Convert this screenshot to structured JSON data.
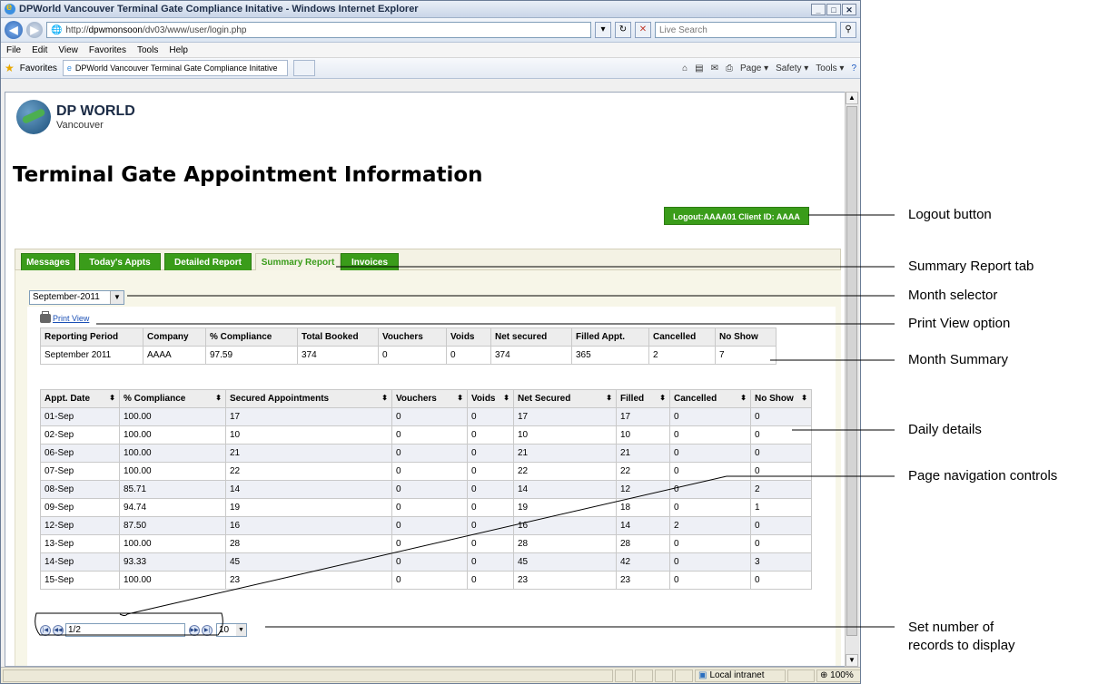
{
  "browser": {
    "title": "DPWorld Vancouver Terminal Gate Compliance Initative - Windows Internet Explorer",
    "address_prefix": "http://",
    "address_host": "dpwmonsoon",
    "address_path": "/dv03/www/user/login.php",
    "search_placeholder": "Live Search",
    "menu": [
      "File",
      "Edit",
      "View",
      "Favorites",
      "Tools",
      "Help"
    ],
    "favorites_label": "Favorites",
    "tab_title": "DPWorld Vancouver Terminal Gate Compliance Initative",
    "commands": [
      "Page ▾",
      "Safety ▾",
      "Tools ▾"
    ],
    "status_zone": "Local intranet",
    "zoom": "100%"
  },
  "page": {
    "logo_name": "DP WORLD",
    "logo_sub": "Vancouver",
    "title": "Terminal Gate Appointment Information",
    "logout_label": "Logout:AAAA01  Client ID: AAAA",
    "tabs": [
      "Messages",
      "Today's Appts",
      "Detailed Report",
      "Summary Report",
      "Invoices"
    ],
    "active_tab": "Summary Report",
    "month": "September-2011",
    "print_view": "Print View"
  },
  "summary_table": {
    "headers": [
      "Reporting Period",
      "Company",
      "% Compliance",
      "Total Booked",
      "Vouchers",
      "Voids",
      "Net secured",
      "Filled Appt.",
      "Cancelled",
      "No Show"
    ],
    "row": [
      "September 2011",
      "AAAA",
      "97.59",
      "374",
      "0",
      "0",
      "374",
      "365",
      "2",
      "7"
    ]
  },
  "daily_table": {
    "headers": [
      "Appt. Date",
      "% Compliance",
      "Secured Appointments",
      "Vouchers",
      "Voids",
      "Net Secured",
      "Filled",
      "Cancelled",
      "No Show"
    ],
    "rows": [
      [
        "01-Sep",
        "100.00",
        "17",
        "0",
        "0",
        "17",
        "17",
        "0",
        "0"
      ],
      [
        "02-Sep",
        "100.00",
        "10",
        "0",
        "0",
        "10",
        "10",
        "0",
        "0"
      ],
      [
        "06-Sep",
        "100.00",
        "21",
        "0",
        "0",
        "21",
        "21",
        "0",
        "0"
      ],
      [
        "07-Sep",
        "100.00",
        "22",
        "0",
        "0",
        "22",
        "22",
        "0",
        "0"
      ],
      [
        "08-Sep",
        "85.71",
        "14",
        "0",
        "0",
        "14",
        "12",
        "0",
        "2"
      ],
      [
        "09-Sep",
        "94.74",
        "19",
        "0",
        "0",
        "19",
        "18",
        "0",
        "1"
      ],
      [
        "12-Sep",
        "87.50",
        "16",
        "0",
        "0",
        "16",
        "14",
        "2",
        "0"
      ],
      [
        "13-Sep",
        "100.00",
        "28",
        "0",
        "0",
        "28",
        "28",
        "0",
        "0"
      ],
      [
        "14-Sep",
        "93.33",
        "45",
        "0",
        "0",
        "45",
        "42",
        "0",
        "3"
      ],
      [
        "15-Sep",
        "100.00",
        "23",
        "0",
        "0",
        "23",
        "23",
        "0",
        "0"
      ]
    ]
  },
  "pager": {
    "page": "1/2",
    "per_page": "10"
  },
  "annotations": {
    "logout": "Logout button",
    "summary_tab": "Summary Report tab",
    "month": "Month selector",
    "print": "Print View option",
    "month_summary": "Month Summary",
    "daily": "Daily details",
    "nav": "Page navigation controls",
    "records_1": "Set number of",
    "records_2": "records to display"
  },
  "colors": {
    "accent_green": "#3a9c1a",
    "panel_bg": "#f7f6e8"
  }
}
